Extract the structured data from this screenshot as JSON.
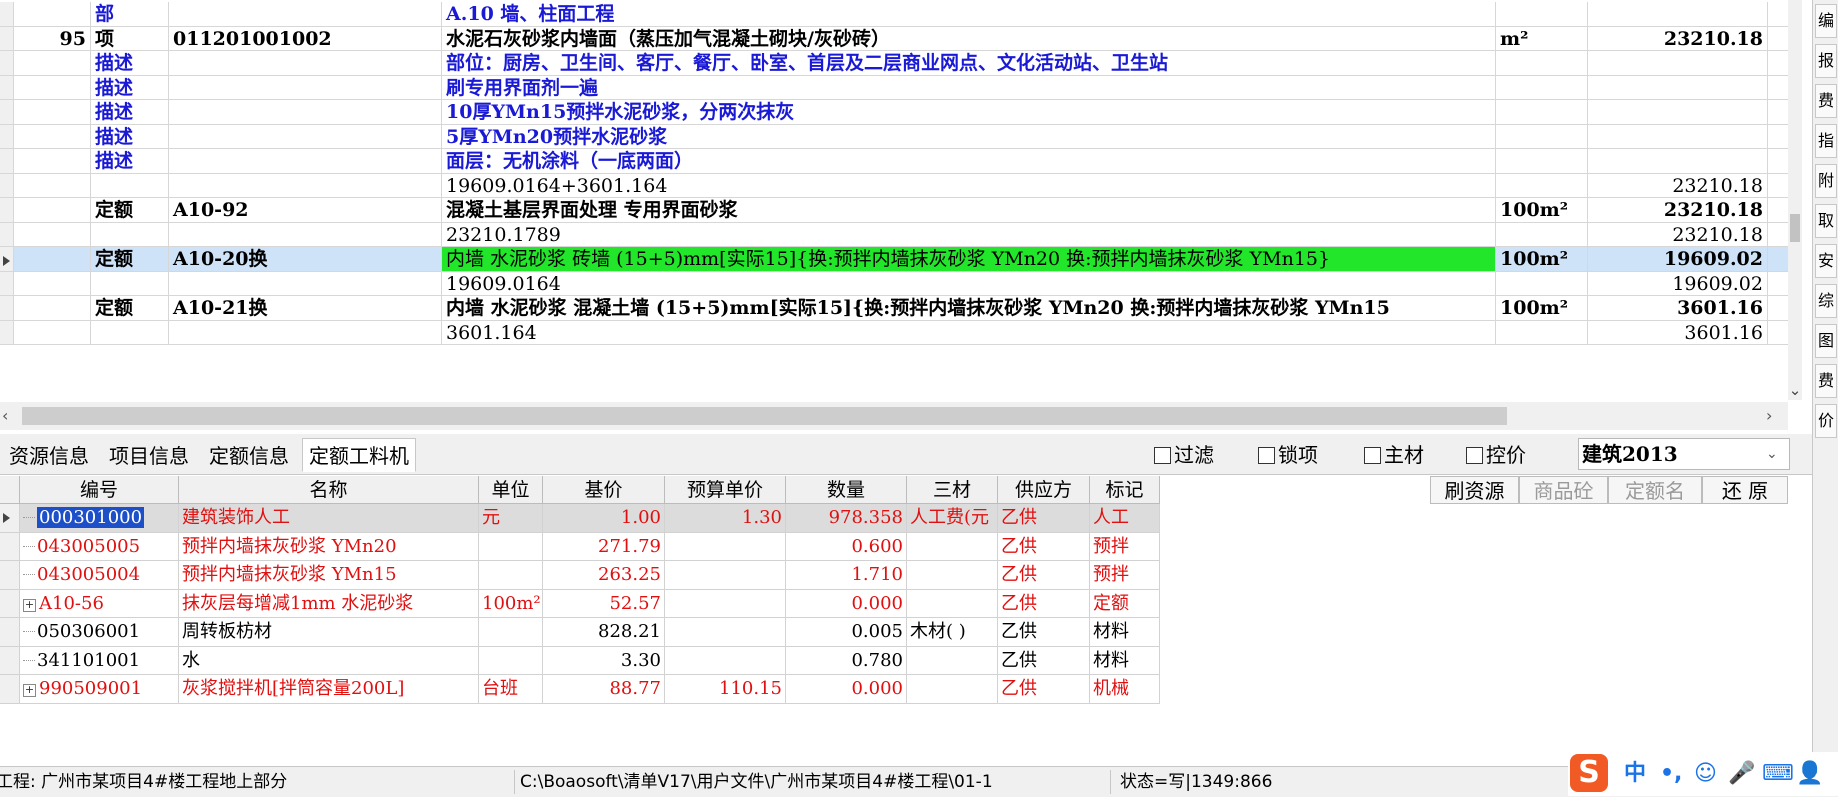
{
  "top_rows": [
    {
      "no": "",
      "type": "部",
      "code": "",
      "name": "A.10 墙、柱面工程",
      "unit": "",
      "qty": "",
      "style": "blue"
    },
    {
      "no": "95",
      "type": "项",
      "code": "011201001002",
      "name": "水泥石灰砂浆内墙面（蒸压加气混凝土砌块/灰砂砖）",
      "unit": "m²",
      "qty": "23210.18",
      "style": "bold"
    },
    {
      "no": "",
      "type": "描述",
      "code": "",
      "name": "部位：厨房、卫生间、客厅、餐厅、卧室、首层及二层商业网点、文化活动站、卫生站",
      "unit": "",
      "qty": "",
      "style": "blue"
    },
    {
      "no": "",
      "type": "描述",
      "code": "",
      "name": "刷专用界面剂一遍",
      "unit": "",
      "qty": "",
      "style": "blue"
    },
    {
      "no": "",
      "type": "描述",
      "code": "",
      "name": "10厚YMn15预拌水泥砂浆，分两次抹灰",
      "unit": "",
      "qty": "",
      "style": "blue"
    },
    {
      "no": "",
      "type": "描述",
      "code": "",
      "name": "5厚YMn20预拌水泥砂浆",
      "unit": "",
      "qty": "",
      "style": "blue"
    },
    {
      "no": "",
      "type": "描述",
      "code": "",
      "name": "面层：无机涂料（一底两面）",
      "unit": "",
      "qty": "",
      "style": "blue"
    },
    {
      "no": "",
      "type": "",
      "code": "",
      "name": "19609.0164+3601.164",
      "unit": "",
      "qty": "23210.18",
      "style": "normal"
    },
    {
      "no": "",
      "type": "定额",
      "code": "A10-92",
      "name": "混凝土基层界面处理 专用界面砂浆",
      "unit": "100m²",
      "qty": "23210.18",
      "style": "bold"
    },
    {
      "no": "",
      "type": "",
      "code": "",
      "name": "23210.1789",
      "unit": "",
      "qty": "23210.18",
      "style": "normal"
    },
    {
      "no": "",
      "type": "定额",
      "code": "A10-20换",
      "name": "内墙 水泥砂浆 砖墙 (15+5)mm[实际15]{换:预拌内墙抹灰砂浆 YMn20 换:预拌内墙抹灰砂浆 YMn15}",
      "unit": "100m²",
      "qty": "19609.02",
      "style": "bold",
      "selected": true
    },
    {
      "no": "",
      "type": "",
      "code": "",
      "name": "19609.0164",
      "unit": "",
      "qty": "19609.02",
      "style": "normal"
    },
    {
      "no": "",
      "type": "定额",
      "code": "A10-21换",
      "name": "内墙 水泥砂浆 混凝土墙 (15+5)mm[实际15]{换:预拌内墙抹灰砂浆 YMn20 换:预拌内墙抹灰砂浆 YMn15",
      "unit": "100m²",
      "qty": "3601.16",
      "style": "bold"
    },
    {
      "no": "",
      "type": "",
      "code": "",
      "name": "3601.164",
      "unit": "",
      "qty": "3601.16",
      "style": "normal"
    }
  ],
  "tabs": [
    "资源信息",
    "项目信息",
    "定额信息",
    "定额工料机"
  ],
  "filters": [
    "过滤",
    "锁项",
    "主材",
    "控价"
  ],
  "combo_value": "建筑2013",
  "bottom_headers": [
    "编号",
    "名称",
    "单位",
    "基价",
    "预算单价",
    "数量",
    "三材",
    "供应方",
    "标记"
  ],
  "bottom_rows": [
    {
      "code": "000301000",
      "name": "建筑装饰人工",
      "unit": "元",
      "base": "1.00",
      "budget": "1.30",
      "qty": "978.358",
      "cat": "人工费(元",
      "sup": "乙供",
      "tag": "人工",
      "red": true,
      "selected": true,
      "expand": false
    },
    {
      "code": "043005005",
      "name": "预拌内墙抹灰砂浆 YMn20",
      "unit": "",
      "base": "271.79",
      "budget": "",
      "qty": "0.600",
      "cat": "",
      "sup": "乙供",
      "tag": "预拌",
      "red": true,
      "expand": false
    },
    {
      "code": "043005004",
      "name": "预拌内墙抹灰砂浆 YMn15",
      "unit": "",
      "base": "263.25",
      "budget": "",
      "qty": "1.710",
      "cat": "",
      "sup": "乙供",
      "tag": "预拌",
      "red": true,
      "expand": false
    },
    {
      "code": "A10-56",
      "name": "抹灰层每增减1mm 水泥砂浆",
      "unit": "100m²",
      "base": "52.57",
      "budget": "",
      "qty": "0.000",
      "cat": "",
      "sup": "乙供",
      "tag": "定额",
      "red": true,
      "expand": true
    },
    {
      "code": "050306001",
      "name": "周转板枋材",
      "unit": "",
      "base": "828.21",
      "budget": "",
      "qty": "0.005",
      "cat": "木材(  )",
      "sup": "乙供",
      "tag": "材料",
      "red": false,
      "expand": false
    },
    {
      "code": "341101001",
      "name": "水",
      "unit": "",
      "base": "3.30",
      "budget": "",
      "qty": "0.780",
      "cat": "",
      "sup": "乙供",
      "tag": "材料",
      "red": false,
      "expand": false
    },
    {
      "code": "990509001",
      "name": "灰浆搅拌机[拌筒容量200L]",
      "unit": "台班",
      "base": "88.77",
      "budget": "110.15",
      "qty": "0.000",
      "cat": "",
      "sup": "乙供",
      "tag": "机械",
      "red": true,
      "expand": true
    }
  ],
  "toolbar_buttons": [
    {
      "label": "刷资源",
      "enabled": true
    },
    {
      "label": "商品砼",
      "enabled": false
    },
    {
      "label": "定额名",
      "enabled": false
    },
    {
      "label": "还 原",
      "enabled": true
    }
  ],
  "side_buttons": [
    "编",
    "报",
    "费",
    "指",
    "附",
    "取",
    "安",
    "综",
    "图",
    "费",
    "价"
  ],
  "status": {
    "project": "工程: 广州市某项目4#楼工程地上部分",
    "path": "C:\\Boaosoft\\清单V17\\用户文件\\广州市某项目4#楼工程\\01-1",
    "state": "状态=写|1349:866"
  },
  "ime": {
    "logo": "S",
    "items": [
      "中",
      "•,",
      "☺",
      "🎤",
      "⌨",
      "👤"
    ]
  },
  "colors": {
    "selected_green": "#22e62a",
    "blue_text": "#1a1ad6",
    "red_text": "#e01010",
    "selection_blue": "#1c4fc8"
  }
}
